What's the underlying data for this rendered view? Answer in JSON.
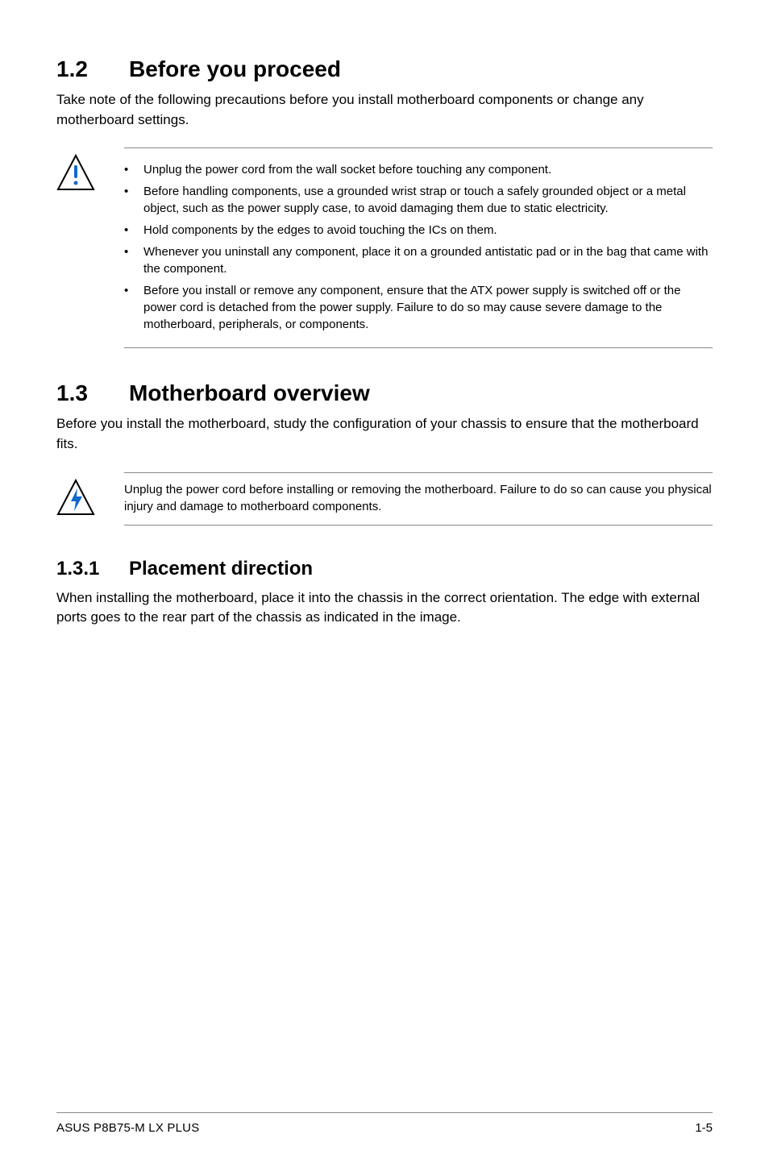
{
  "section_1_2": {
    "num": "1.2",
    "title": "Before you proceed",
    "lead": "Take note of the following precautions before you install motherboard components or change any motherboard settings.",
    "callout_icon_name": "caution-icon",
    "bullets": [
      "Unplug the power cord from the wall socket before touching any component.",
      "Before handling components, use a grounded wrist strap or touch a safely grounded object or a metal object, such as the power supply case, to avoid damaging them due to static electricity.",
      "Hold components by the edges to avoid touching the ICs on them.",
      "Whenever you uninstall any component, place it on a grounded antistatic pad or in the bag that came with the component.",
      "Before you install or remove any component, ensure that the ATX power supply is switched off or the power cord is detached from the power supply. Failure to do so may cause severe damage to the motherboard, peripherals, or components."
    ]
  },
  "section_1_3": {
    "num": "1.3",
    "title": "Motherboard overview",
    "lead": "Before you install the motherboard, study the configuration of your chassis to ensure that the motherboard fits.",
    "callout_icon_name": "danger-icon",
    "callout_text": "Unplug the power cord before installing or removing the motherboard. Failure to do so can cause you physical injury and damage to motherboard components."
  },
  "section_1_3_1": {
    "num": "1.3.1",
    "title": "Placement direction",
    "lead": "When installing the motherboard, place it into the chassis in the correct orientation. The edge with external ports goes to the rear part of the chassis as indicated in the image."
  },
  "footer": {
    "left": "ASUS P8B75-M LX PLUS",
    "right": "1-5"
  }
}
